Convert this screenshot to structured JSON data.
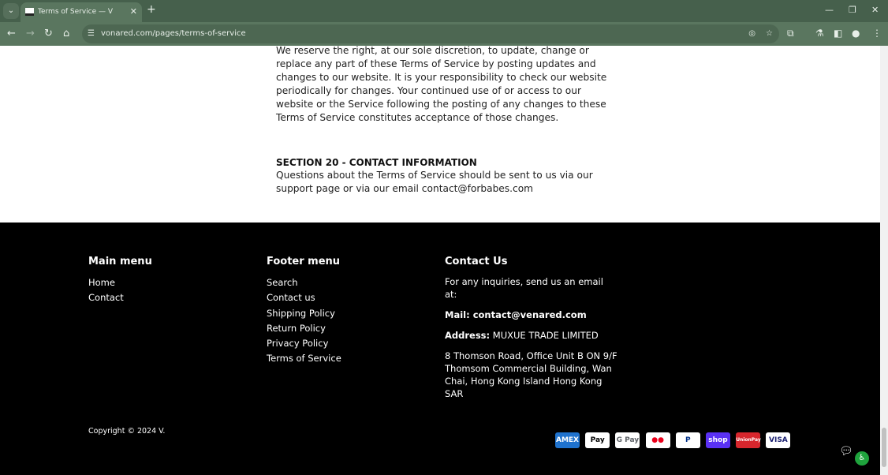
{
  "browser": {
    "tab_title": "Terms of Service — V",
    "url": "vonared.com/pages/terms-of-service"
  },
  "content": {
    "paragraph": "We reserve the right, at our sole discretion, to update, change or replace any part of these Terms of Service by posting updates and changes to our website. It is your responsibility to check our website periodically for changes. Your continued use of or access to our website or the Service following the posting of any changes to these Terms of Service constitutes acceptance of those changes.",
    "section_title": "SECTION 20 - CONTACT INFORMATION",
    "section_text": "Questions about the Terms of Service should be sent to us via our support page or via our email contact@forbabes.com"
  },
  "footer": {
    "main_menu": {
      "title": "Main menu",
      "items": [
        "Home",
        "Contact"
      ]
    },
    "footer_menu": {
      "title": "Footer menu",
      "items": [
        "Search",
        "Contact us",
        "Shipping Policy",
        "Return Policy",
        "Privacy Policy",
        "Terms of Service"
      ]
    },
    "contact": {
      "title": "Contact Us",
      "intro": "For any inquiries, send us an email at:",
      "mail": "Mail: contact@venared.com",
      "address_label": "Address:",
      "address_name": "MUXUE TRADE LIMITED",
      "address": "8 Thomson Road, Office Unit B ON 9/F Thomsom Commercial Building, Wan Chai, Hong Kong Island Hong Kong SAR"
    },
    "copyright": "Copyright © 2024 V.",
    "payments": [
      {
        "label": "AMEX",
        "bg": "#1f72cd",
        "fg": "#ffffff"
      },
      {
        "label": "Pay",
        "bg": "#ffffff",
        "fg": "#000000"
      },
      {
        "label": "G Pay",
        "bg": "#ffffff",
        "fg": "#5f6368"
      },
      {
        "label": "●●",
        "bg": "#ffffff",
        "fg": "#eb001b"
      },
      {
        "label": "P",
        "bg": "#ffffff",
        "fg": "#003087"
      },
      {
        "label": "shop",
        "bg": "#5a31f4",
        "fg": "#ffffff"
      },
      {
        "label": "UnionPay",
        "bg": "#d7262d",
        "fg": "#ffffff"
      },
      {
        "label": "VISA",
        "bg": "#ffffff",
        "fg": "#1a1f71"
      }
    ]
  }
}
